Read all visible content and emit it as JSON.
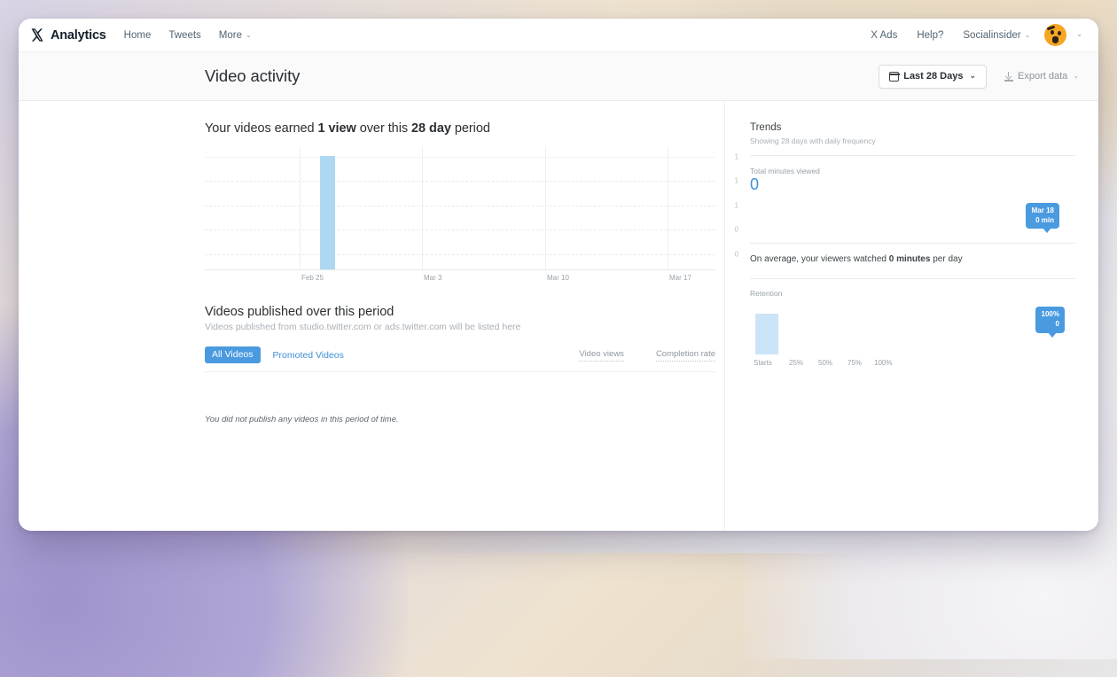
{
  "nav": {
    "brand": "Analytics",
    "logo_icon": "x-logo-icon",
    "left_links": [
      {
        "label": "Home",
        "caret": false
      },
      {
        "label": "Tweets",
        "caret": false
      },
      {
        "label": "More",
        "caret": true
      }
    ],
    "right_links": [
      {
        "label": "X Ads",
        "caret": false
      },
      {
        "label": "Help?",
        "caret": false
      },
      {
        "label": "Socialinsider",
        "caret": true
      }
    ],
    "caret_glyph": "⌄",
    "avatar_name": "user-avatar"
  },
  "header": {
    "title": "Video activity",
    "date_range": "Last 28 Days",
    "calendar_icon": "calendar-icon",
    "export_label": "Export data",
    "export_icon": "download-icon"
  },
  "summary": {
    "prefix": "Your videos earned ",
    "views": "1 view",
    "middle": " over this ",
    "period": "28 day",
    "suffix": " period"
  },
  "published": {
    "title": "Videos published over this period",
    "subtitle": "Videos published from studio.twitter.com or ads.twitter.com will be listed here",
    "tabs": [
      {
        "label": "All Videos",
        "active": true
      },
      {
        "label": "Promoted Videos",
        "active": false
      }
    ],
    "metrics": [
      {
        "label": "Video views"
      },
      {
        "label": "Completion rate"
      }
    ],
    "empty_message": "You did not publish any videos in this period of time."
  },
  "sidebar": {
    "trends_title": "Trends",
    "trends_sub": "Showing 28 days with daily frequency",
    "total_minutes_label": "Total minutes viewed",
    "total_minutes_value": "0",
    "trend_tooltip_date": "Mar 18",
    "trend_tooltip_value": "0 min",
    "average_prefix": "On average, your viewers watched ",
    "average_bold": "0 minutes",
    "average_suffix": " per day",
    "retention_label": "Retention",
    "retention_tooltip_pct": "100%",
    "retention_tooltip_value": "0"
  },
  "chart_data": {
    "type": "bar",
    "title": "Video views over 28 day period",
    "xlabel": "",
    "ylabel": "",
    "x_ticks": [
      "Feb 25",
      "Mar 3",
      "Mar 10",
      "Mar 17"
    ],
    "x_tick_positions_pct": [
      18.5,
      43.5,
      67.5,
      91.5
    ],
    "y_ticks": [
      "1",
      "1",
      "1",
      "0",
      "0"
    ],
    "ylim": [
      0,
      1
    ],
    "grid": true,
    "legend": "none",
    "bar_color": "#aed8f2",
    "categories": [
      "Feb 25"
    ],
    "values": [
      1
    ],
    "bar_position_pct": 22.5,
    "bar_width_pct": 3.0
  },
  "retention_chart_data": {
    "type": "bar",
    "title": "Retention",
    "categories": [
      "Starts",
      "25%",
      "50%",
      "75%",
      "100%"
    ],
    "values": [
      100,
      0,
      0,
      0,
      0
    ],
    "ylim": [
      0,
      100
    ],
    "bar_color": "#cbe4f7",
    "grid": false,
    "legend": "none"
  }
}
